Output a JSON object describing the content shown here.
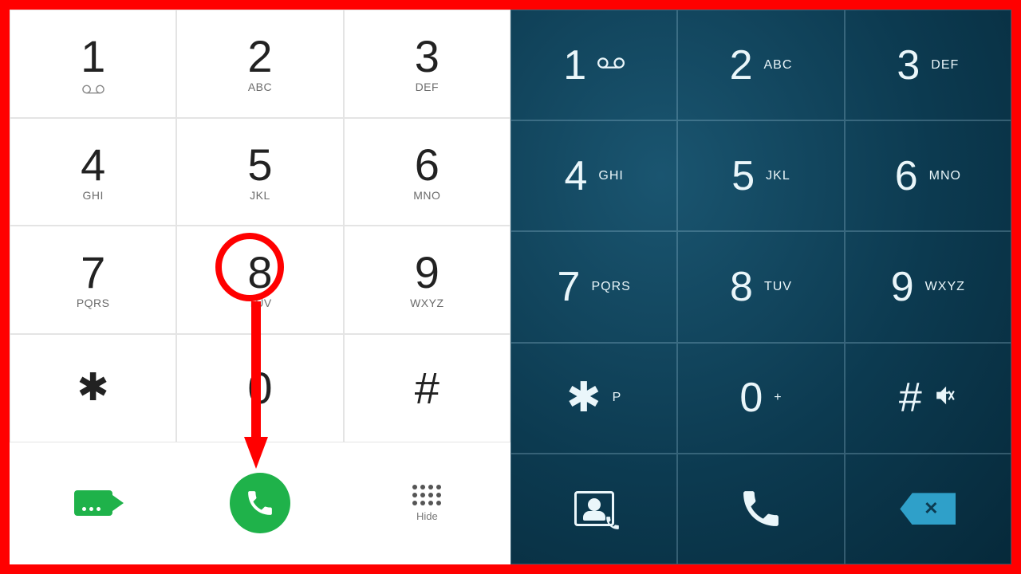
{
  "left_dialer": {
    "keys": [
      {
        "digit": "1",
        "sub": "voicemail"
      },
      {
        "digit": "2",
        "sub": "ABC"
      },
      {
        "digit": "3",
        "sub": "DEF"
      },
      {
        "digit": "4",
        "sub": "GHI"
      },
      {
        "digit": "5",
        "sub": "JKL"
      },
      {
        "digit": "6",
        "sub": "MNO"
      },
      {
        "digit": "7",
        "sub": "PQRS"
      },
      {
        "digit": "8",
        "sub": "TUV"
      },
      {
        "digit": "9",
        "sub": "WXYZ"
      },
      {
        "digit": "✱",
        "sub": ""
      },
      {
        "digit": "0",
        "sub": ""
      },
      {
        "digit": "#",
        "sub": ""
      }
    ],
    "hide_label": "Hide",
    "highlight_key": "8",
    "annotation": "red-circle-arrow-from-8-to-call"
  },
  "right_dialer": {
    "keys": [
      {
        "digit": "1",
        "sub": "voicemail"
      },
      {
        "digit": "2",
        "sub": "ABC"
      },
      {
        "digit": "3",
        "sub": "DEF"
      },
      {
        "digit": "4",
        "sub": "GHI"
      },
      {
        "digit": "5",
        "sub": "JKL"
      },
      {
        "digit": "6",
        "sub": "MNO"
      },
      {
        "digit": "7",
        "sub": "PQRS"
      },
      {
        "digit": "8",
        "sub": "TUV"
      },
      {
        "digit": "9",
        "sub": "WXYZ"
      },
      {
        "digit": "✱",
        "sub": "P"
      },
      {
        "digit": "0",
        "sub": "+"
      },
      {
        "digit": "#",
        "sub": "mute"
      }
    ],
    "highlight_key": "✱",
    "annotation": "green-circle-arrow-from-star-to-call"
  },
  "colors": {
    "frame": "#ff0000",
    "call_green": "#1fb24a",
    "dark_bg": "#0c3a50",
    "annotation_green": "#00e613"
  }
}
